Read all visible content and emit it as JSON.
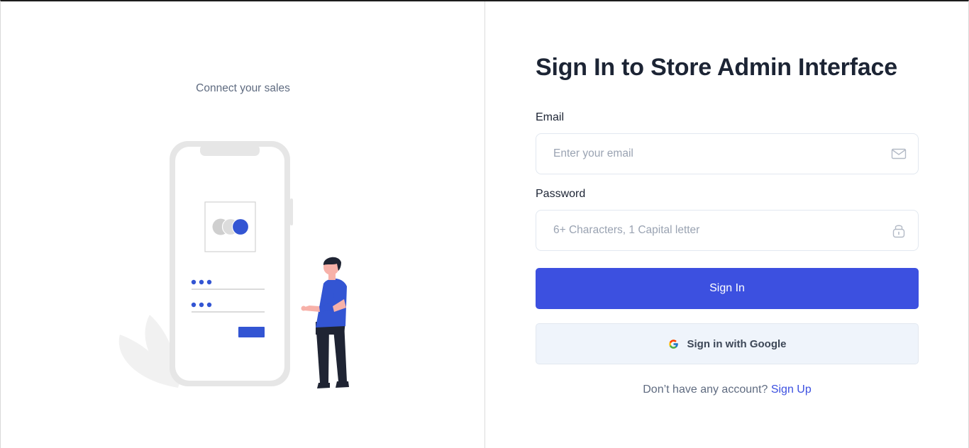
{
  "left": {
    "tagline": "Connect your sales"
  },
  "form": {
    "title": "Sign In to Store Admin Interface",
    "email_label": "Email",
    "email_placeholder": "Enter your email",
    "email_value": "",
    "password_label": "Password",
    "password_placeholder": "6+ Characters, 1 Capital letter",
    "password_value": "",
    "signin_label": "Sign In",
    "google_label": "Sign in with Google",
    "signup_prompt": "Don’t have any account?",
    "signup_link": "Sign Up"
  },
  "colors": {
    "primary": "#3c50e0",
    "google_bg": "#eff4fb",
    "text_dark": "#1c2434",
    "text_muted": "#5f6b80"
  },
  "icons": {
    "email": "envelope-icon",
    "password": "lock-icon",
    "google": "google-logo-icon"
  }
}
